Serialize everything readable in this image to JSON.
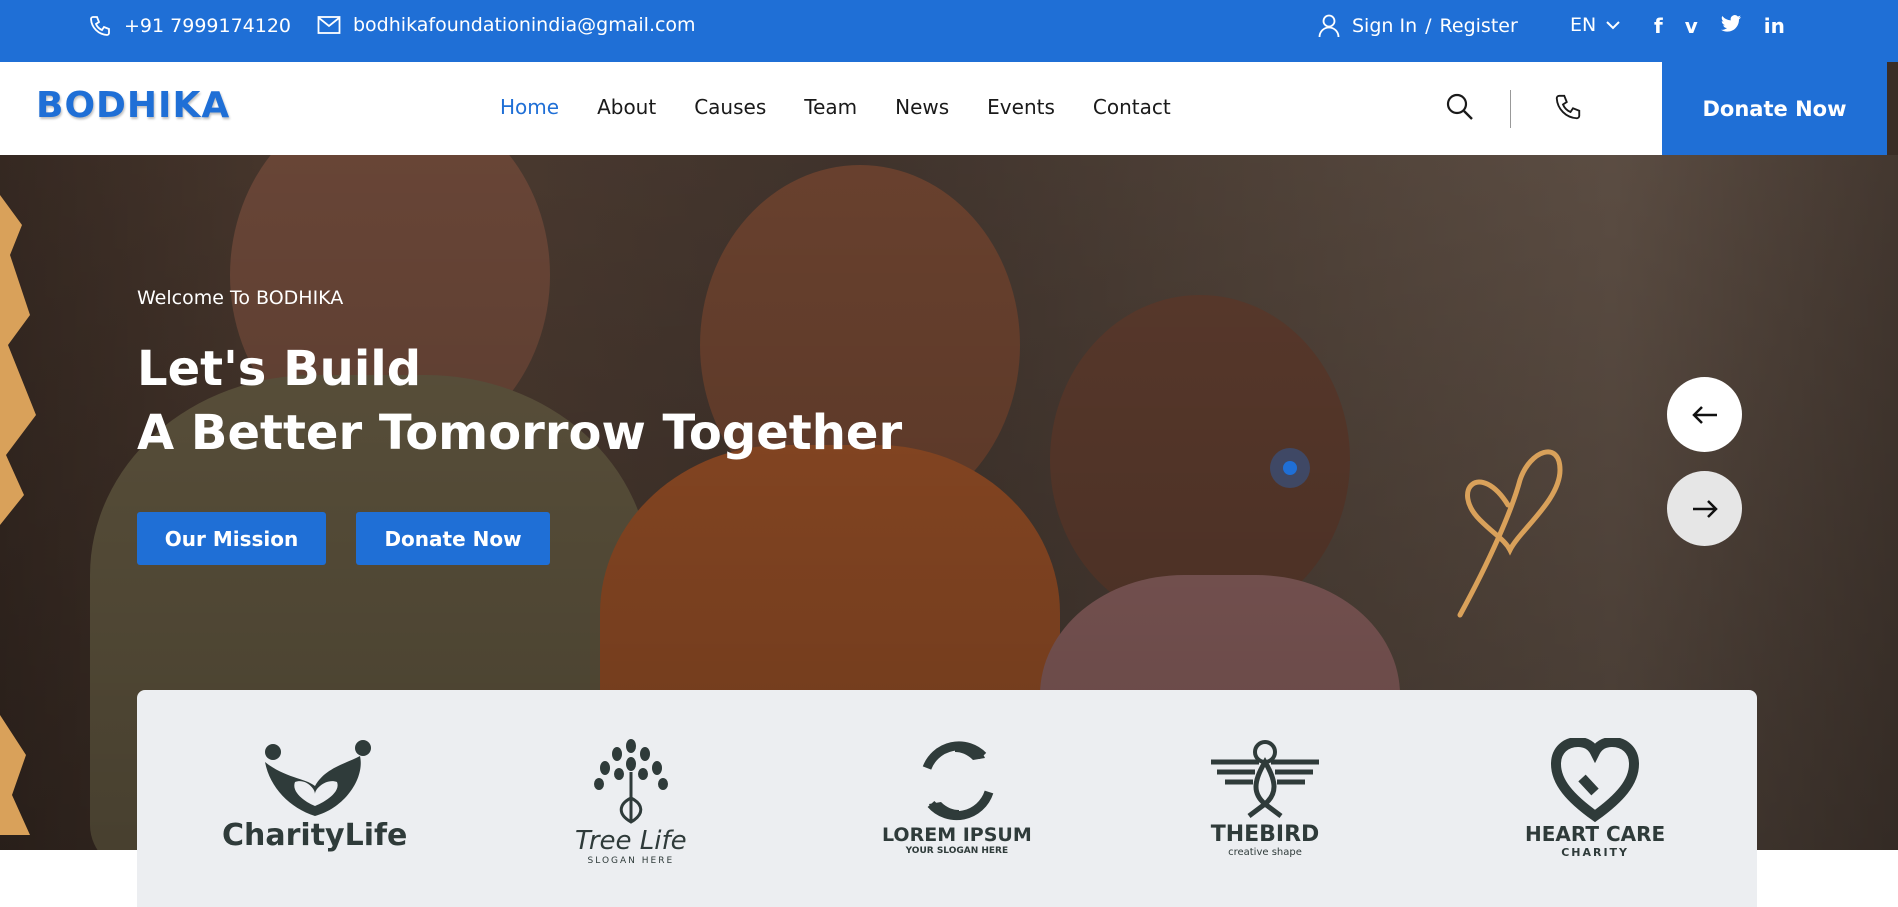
{
  "topbar": {
    "phone": "+91 7999174120",
    "email": "bodhikafoundationindia@gmail.com",
    "signin": "Sign In",
    "slash": "/",
    "register": "Register",
    "language": "EN",
    "social": [
      "f",
      "v",
      "t",
      "in"
    ]
  },
  "nav": {
    "brand": "BODHIKA",
    "items": [
      "Home",
      "About",
      "Causes",
      "Team",
      "News",
      "Events",
      "Contact"
    ],
    "active": "Home",
    "donate": "Donate Now"
  },
  "hero": {
    "welcome": "Welcome To BODHIKA",
    "line1": "Let's Build",
    "line2": "A Better Tomorrow Together",
    "mission_btn": "Our Mission",
    "donate_btn": "Donate Now"
  },
  "logos": [
    {
      "name": "CharityLife",
      "sub": ""
    },
    {
      "name": "Tree Life",
      "sub": "SLOGAN HERE"
    },
    {
      "name": "LOREM IPSUM",
      "sub": "YOUR SLOGAN HERE"
    },
    {
      "name": "THEBIRD",
      "sub": "creative shape"
    },
    {
      "name": "HEART CARE",
      "sub": "CHARITY"
    }
  ],
  "colors": {
    "brand": "#1f6fd6",
    "accent": "#d9a15a"
  }
}
